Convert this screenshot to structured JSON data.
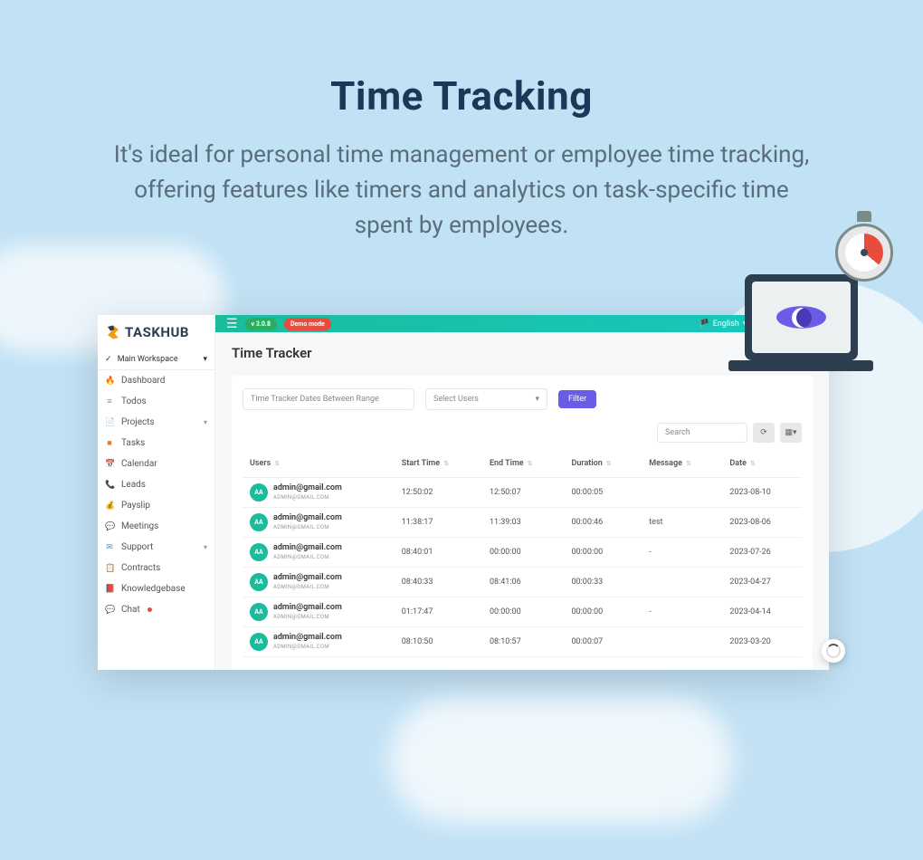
{
  "hero": {
    "title": "Time Tracking",
    "subtitle": "It's ideal for personal time management or employee time tracking, offering features like timers and analytics on task-specific time spent by employees."
  },
  "logo_text": "TASKHUB",
  "workspace": {
    "label": "Main Workspace"
  },
  "sidebar": {
    "items": [
      {
        "icon": "🔥",
        "color": "#e74c3c",
        "label": "Dashboard"
      },
      {
        "icon": "≡",
        "color": "#888",
        "label": "Todos"
      },
      {
        "icon": "📄",
        "color": "#3498db",
        "label": "Projects",
        "caret": true
      },
      {
        "icon": "■",
        "color": "#e67e22",
        "label": "Tasks"
      },
      {
        "icon": "📅",
        "color": "#e74c3c",
        "label": "Calendar"
      },
      {
        "icon": "📞",
        "color": "#e74c3c",
        "label": "Leads"
      },
      {
        "icon": "💰",
        "color": "#27ae60",
        "label": "Payslip"
      },
      {
        "icon": "💬",
        "color": "#1abc9c",
        "label": "Meetings"
      },
      {
        "icon": "✉",
        "color": "#3498db",
        "label": "Support",
        "caret": true
      },
      {
        "icon": "📋",
        "color": "#f39c12",
        "label": "Contracts"
      },
      {
        "icon": "📕",
        "color": "#e74c3c",
        "label": "Knowledgebase"
      },
      {
        "icon": "💬",
        "color": "#27ae60",
        "label": "Chat",
        "dot": true
      }
    ]
  },
  "topbar": {
    "version": "v 3.0.8",
    "mode": "Demo mode",
    "language": "English"
  },
  "page": {
    "title": "Time Tracker"
  },
  "filters": {
    "date_placeholder": "Time Tracker Dates Between Range",
    "select_placeholder": "Select Users",
    "filter_btn": "Filter",
    "search_placeholder": "Search"
  },
  "table": {
    "headers": {
      "users": "Users",
      "start": "Start Time",
      "end": "End Time",
      "duration": "Duration",
      "message": "Message",
      "date": "Date"
    },
    "rows": [
      {
        "avatar": "AA",
        "email": "admin@gmail.com",
        "sub": "ADMIN@GMAIL.COM",
        "start": "12:50:02",
        "end": "12:50:07",
        "duration": "00:00:05",
        "message": "",
        "date": "2023-08-10"
      },
      {
        "avatar": "AA",
        "email": "admin@gmail.com",
        "sub": "ADMIN@GMAIL.COM",
        "start": "11:38:17",
        "end": "11:39:03",
        "duration": "00:00:46",
        "message": "test",
        "date": "2023-08-06"
      },
      {
        "avatar": "AA",
        "email": "admin@gmail.com",
        "sub": "ADMIN@GMAIL.COM",
        "start": "08:40:01",
        "end": "00:00:00",
        "duration": "00:00:00",
        "message": "-",
        "date": "2023-07-26"
      },
      {
        "avatar": "AA",
        "email": "admin@gmail.com",
        "sub": "ADMIN@GMAIL.COM",
        "start": "08:40:33",
        "end": "08:41:06",
        "duration": "00:00:33",
        "message": "",
        "date": "2023-04-27"
      },
      {
        "avatar": "AA",
        "email": "admin@gmail.com",
        "sub": "ADMIN@GMAIL.COM",
        "start": "01:17:47",
        "end": "00:00:00",
        "duration": "00:00:00",
        "message": "-",
        "date": "2023-04-14"
      },
      {
        "avatar": "AA",
        "email": "admin@gmail.com",
        "sub": "ADMIN@GMAIL.COM",
        "start": "08:10:50",
        "end": "08:10:57",
        "duration": "00:00:07",
        "message": "",
        "date": "2023-03-20"
      }
    ]
  }
}
